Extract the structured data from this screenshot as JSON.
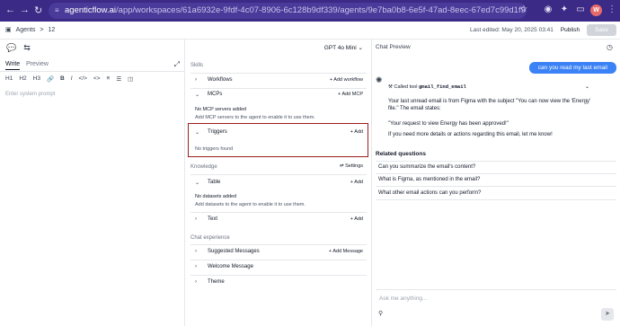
{
  "browser": {
    "url_host": "agenticflow.ai",
    "url_path": "/app/workspaces/61a6932e-9fdf-4c07-8906-6c128b9df339/agents/9e7ba0b8-6e5f-47ad-8eec-67ed7c99d1f9?threadId=c1eb...",
    "avatar_letter": "W"
  },
  "topbar": {
    "crumb_root": "Agents",
    "crumb_sep": ">",
    "crumb_current": "12",
    "last_edited": "Last edited: May 20, 2025 03:41",
    "publish": "Publish",
    "save": "Save"
  },
  "editor": {
    "tab_write": "Write",
    "tab_preview": "Preview",
    "fmt": [
      "H1",
      "H2",
      "H3",
      "🔗",
      "B",
      "I",
      "</>",
      "<>",
      "≡",
      "☰",
      "◫"
    ],
    "placeholder": "Enter system prompt"
  },
  "config": {
    "model": "GPT 4o Mini",
    "skills_label": "Skills",
    "workflows": "Workflows",
    "add_workflow": "+ Add workflow",
    "mcps": "MCPs",
    "add_mcp": "+ Add MCP",
    "no_mcp_title": "No MCP servers added",
    "no_mcp_sub": "Add MCP servers to the agent to enable it to use them.",
    "triggers": "Triggers",
    "add_trigger": "+ Add",
    "no_triggers": "No triggers found",
    "knowledge_label": "Knowledge",
    "settings": "Settings",
    "table": "Table",
    "add_table": "+ Add",
    "no_datasets_title": "No datasets added",
    "no_datasets_sub": "Add datasets to the agent to enable it to use them.",
    "text": "Text",
    "add_text": "+ Add",
    "chat_exp_label": "Chat experience",
    "suggested": "Suggested Messages",
    "add_message": "+ Add Message",
    "welcome": "Welcome Message",
    "theme": "Theme"
  },
  "chat": {
    "title": "Chat Preview",
    "user_msg": "can you read my last email",
    "tool_prefix": "Called tool",
    "tool_name": "gmail_find_email",
    "reply_1": "Your last unread email is from Figma with the subject \"You can now view the 'Energy' file.\" The email states:",
    "reply_2": "\"Your request to view Energy has been approved!\"",
    "reply_3": "If you need more details or actions regarding this email, let me know!",
    "related_title": "Related questions",
    "related": [
      "Can you summarize the email's content?",
      "What is Figma, as mentioned in the email?",
      "What other email actions can you perform?"
    ],
    "input_placeholder": "Ask me anything..."
  }
}
